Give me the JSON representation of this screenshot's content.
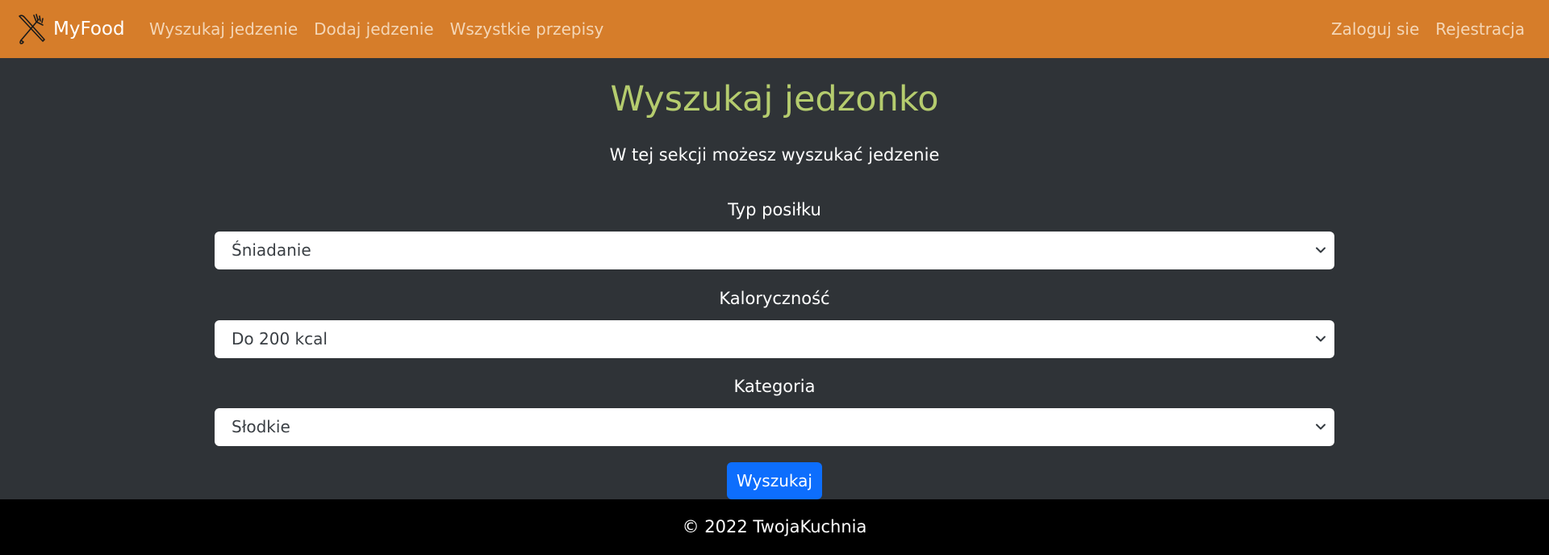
{
  "navbar": {
    "brand": "MyFood",
    "brand_icon": "fork-knife-icon",
    "links_left": [
      {
        "label": "Wyszukaj jedzenie"
      },
      {
        "label": "Dodaj jedzenie"
      },
      {
        "label": "Wszystkie przepisy"
      }
    ],
    "links_right": [
      {
        "label": "Zaloguj sie"
      },
      {
        "label": "Rejestracja"
      }
    ],
    "colors": {
      "background": "#d67d2a",
      "link": "#f4d6b6",
      "brand": "#ffffff"
    }
  },
  "main": {
    "title": "Wyszukaj jedzonko",
    "subtitle": "W tej sekcji możesz wyszukać jedzenie",
    "fields": [
      {
        "label": "Typ posiłku",
        "value": "Śniadanie"
      },
      {
        "label": "Kaloryczność",
        "value": "Do 200 kcal"
      },
      {
        "label": "Kategoria",
        "value": "Słodkie"
      }
    ],
    "search_button": "Wyszukaj",
    "colors": {
      "background": "#2f3337",
      "title": "#b5cc6e",
      "button": "#0d6efd"
    }
  },
  "footer": {
    "text": "© 2022 TwojaKuchnia"
  }
}
